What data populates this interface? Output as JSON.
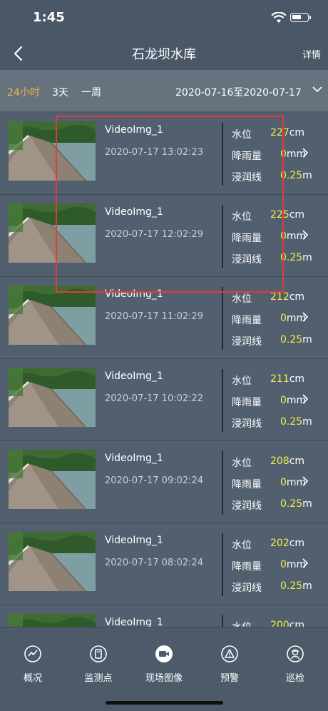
{
  "status_bar": {
    "time": "1:45"
  },
  "header": {
    "title": "石龙坝水库",
    "detail_label": "详情"
  },
  "filters": {
    "options": [
      {
        "label": "24小时",
        "active": true
      },
      {
        "label": "3天",
        "active": false
      },
      {
        "label": "一周",
        "active": false
      }
    ],
    "date_range": "2020-07-16至2020-07-17"
  },
  "metric_labels": {
    "water_level": "水位",
    "rainfall": "降雨量",
    "seepage": "浸润线"
  },
  "records": [
    {
      "name": "VideoImg_1",
      "timestamp": "2020-07-17 13:02:23",
      "water_level": "227",
      "water_unit": "cm",
      "rainfall": "0",
      "rain_unit": "mm",
      "seepage": "0.25",
      "seep_unit": "m"
    },
    {
      "name": "VideoImg_1",
      "timestamp": "2020-07-17 12:02:29",
      "water_level": "225",
      "water_unit": "cm",
      "rainfall": "0",
      "rain_unit": "mm",
      "seepage": "0.25",
      "seep_unit": "m"
    },
    {
      "name": "VideoImg_1",
      "timestamp": "2020-07-17 11:02:29",
      "water_level": "212",
      "water_unit": "cm",
      "rainfall": "0",
      "rain_unit": "mm",
      "seepage": "0.25",
      "seep_unit": "m"
    },
    {
      "name": "VideoImg_1",
      "timestamp": "2020-07-17 10:02:22",
      "water_level": "211",
      "water_unit": "cm",
      "rainfall": "0",
      "rain_unit": "mm",
      "seepage": "0.25",
      "seep_unit": "m"
    },
    {
      "name": "VideoImg_1",
      "timestamp": "2020-07-17 09:02:24",
      "water_level": "208",
      "water_unit": "cm",
      "rainfall": "0",
      "rain_unit": "mm",
      "seepage": "0.25",
      "seep_unit": "m"
    },
    {
      "name": "VideoImg_1",
      "timestamp": "2020-07-17 08:02:24",
      "water_level": "202",
      "water_unit": "cm",
      "rainfall": "0",
      "rain_unit": "mm",
      "seepage": "0.25",
      "seep_unit": "m"
    },
    {
      "name": "VideoImg_1",
      "timestamp": "",
      "water_level": "200",
      "water_unit": "cm",
      "rainfall": "",
      "rain_unit": "",
      "seepage": "",
      "seep_unit": ""
    }
  ],
  "tabs": [
    {
      "label": "概况",
      "icon": "overview-chart-icon",
      "active": false
    },
    {
      "label": "监测点",
      "icon": "monitor-device-icon",
      "active": false
    },
    {
      "label": "现场图像",
      "icon": "camera-video-icon",
      "active": true
    },
    {
      "label": "预警",
      "icon": "warning-triangle-icon",
      "active": false
    },
    {
      "label": "巡检",
      "icon": "patrol-inspector-icon",
      "active": false
    }
  ],
  "colors": {
    "accent_active_filter": "#f0b24a",
    "value_yellow": "#f0f048",
    "highlight_box": "#e23b3b"
  }
}
